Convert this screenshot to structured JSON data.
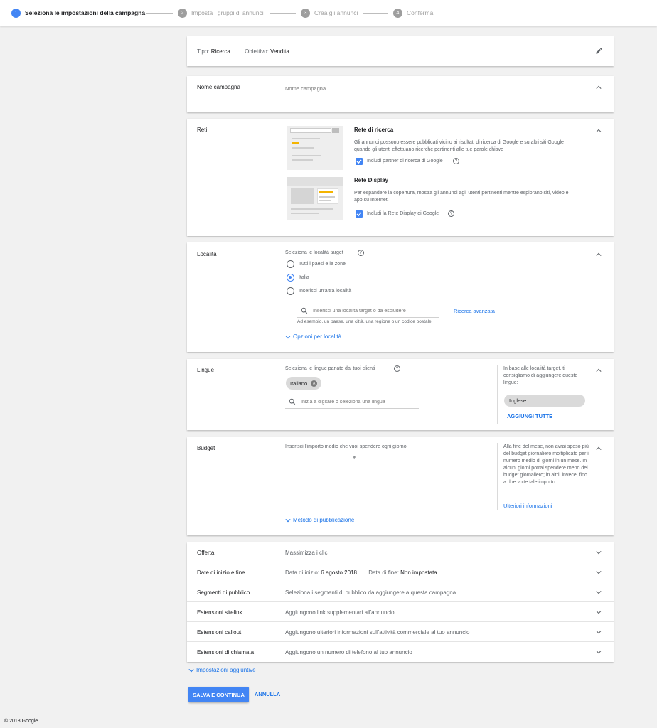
{
  "steps": [
    {
      "num": "1",
      "label": "Seleziona le impostazioni della campagna"
    },
    {
      "num": "2",
      "label": "Imposta i gruppi di annunci"
    },
    {
      "num": "3",
      "label": "Crea gli annunci"
    },
    {
      "num": "4",
      "label": "Conferma"
    }
  ],
  "campaign_type": {
    "tipo_label": "Tipo:",
    "tipo_value": "Ricerca",
    "obiettivo_label": "Obiettivo:",
    "obiettivo_value": "Vendita"
  },
  "nome": {
    "title": "Nome campagna",
    "placeholder": "Nome campagna"
  },
  "reti": {
    "title": "Reti",
    "search_title": "Rete di ricerca",
    "search_desc": "Gli annunci possono essere pubblicati vicino ai risultati di ricerca di Google e su altri siti Google quando gli utenti effettuano ricerche pertinenti alle tue parole chiave",
    "search_check": "Includi partner di ricerca di Google",
    "display_title": "Rete Display",
    "display_desc": "Per espandere la copertura, mostra gli annunci agli utenti pertinenti mentre esplorano siti, video e app su Internet.",
    "display_check": "Includi la Rete Display di Google"
  },
  "localita": {
    "title": "Località",
    "prompt": "Seleziona le località target",
    "options": [
      "Tutti i paesi e le zone",
      "Italia",
      "Inserisci un'altra località"
    ],
    "search_placeholder": "Inserisci una località target o da escludere",
    "advanced": "Ricerca avanzata",
    "hint": "Ad esempio, un paese, una città, una regione o un codice postale",
    "more": "Opzioni per località"
  },
  "lingue": {
    "title": "Lingue",
    "prompt": "Seleziona le lingue parlate dai tuoi clienti",
    "chip": "Italiano",
    "search_placeholder": "Inizia a digitare o seleziona una lingua",
    "side_text": "In base alle località target, ti consigliamo di aggiungere queste lingue:",
    "suggestion": "Inglese",
    "add_all": "AGGIUNGI TUTTE"
  },
  "budget": {
    "title": "Budget",
    "prompt": "Inserisci l'importo medio che vuoi spendere ogni giorno",
    "currency": "€",
    "side_text": "Alla fine del mese, non avrai speso più del budget giornaliero moltiplicato per il numero medio di giorni in un mese. In alcuni giorni potrai spendere meno del budget giornaliero; in altri, invece, fino a due volte tale importo.",
    "more_info": "Ulteriori informazioni",
    "method": "Metodo di pubblicazione"
  },
  "rows": [
    {
      "title": "Offerta",
      "value": "Massimizza i clic"
    },
    {
      "title": "Date di inizio e fine",
      "start_label": "Data di inizio:",
      "start_value": "6 agosto 2018",
      "end_label": "Data di fine:",
      "end_value": "Non impostata"
    },
    {
      "title": "Segmenti di pubblico",
      "value": "Seleziona i segmenti di pubblico da aggiungere a questa campagna"
    },
    {
      "title": "Estensioni sitelink",
      "value": "Aggiungono link supplementari all'annuncio"
    },
    {
      "title": "Estensioni callout",
      "value": "Aggiungono ulteriori informazioni sull'attività commerciale al tuo annuncio"
    },
    {
      "title": "Estensioni di chiamata",
      "value": "Aggiungono un numero di telefono al tuo annuncio"
    }
  ],
  "extra_settings": "Impostazioni aggiuntive",
  "actions": {
    "save": "SALVA E CONTINUA",
    "cancel": "ANNULLA"
  },
  "footer": "© 2018 Google",
  "colors": {
    "accent": "#4285f4",
    "link": "#1a73e8"
  }
}
